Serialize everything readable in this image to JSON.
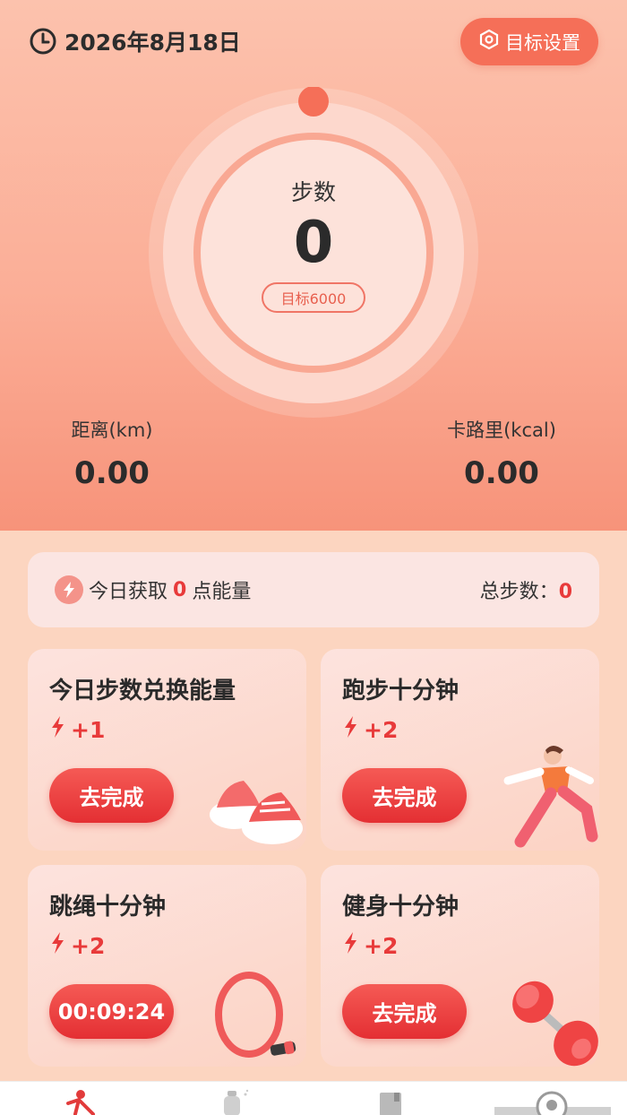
{
  "header": {
    "date": "2026年8月18日",
    "goal_button_label": "目标设置"
  },
  "ring": {
    "label": "步数",
    "value": "0",
    "target_label": "目标6000",
    "progress": 0
  },
  "stats": {
    "distance_label": "距离(km)",
    "distance_value": "0.00",
    "calories_label": "卡路里(kcal)",
    "calories_value": "0.00"
  },
  "energy": {
    "prefix": "今日获取",
    "points": "0",
    "suffix": "点能量",
    "total_label": "总步数：",
    "total_value": "0"
  },
  "tasks": [
    {
      "title": "今日步数兑换能量",
      "points": "+1",
      "button": "去完成",
      "art": "sneakers"
    },
    {
      "title": "跑步十分钟",
      "points": "+2",
      "button": "去完成",
      "art": "runner"
    },
    {
      "title": "跳绳十分钟",
      "points": "+2",
      "button": "00:09:24",
      "art": "jump-rope"
    },
    {
      "title": "健身十分钟",
      "points": "+2",
      "button": "去完成",
      "art": "dumbbell"
    }
  ],
  "colors": {
    "accent": "#f56f58",
    "points_red": "#e83a3a",
    "button_red": "#e42f33"
  },
  "tabbar": {
    "icons": [
      "walk-icon",
      "bottle-icon",
      "book-icon",
      "profile-icon"
    ]
  }
}
